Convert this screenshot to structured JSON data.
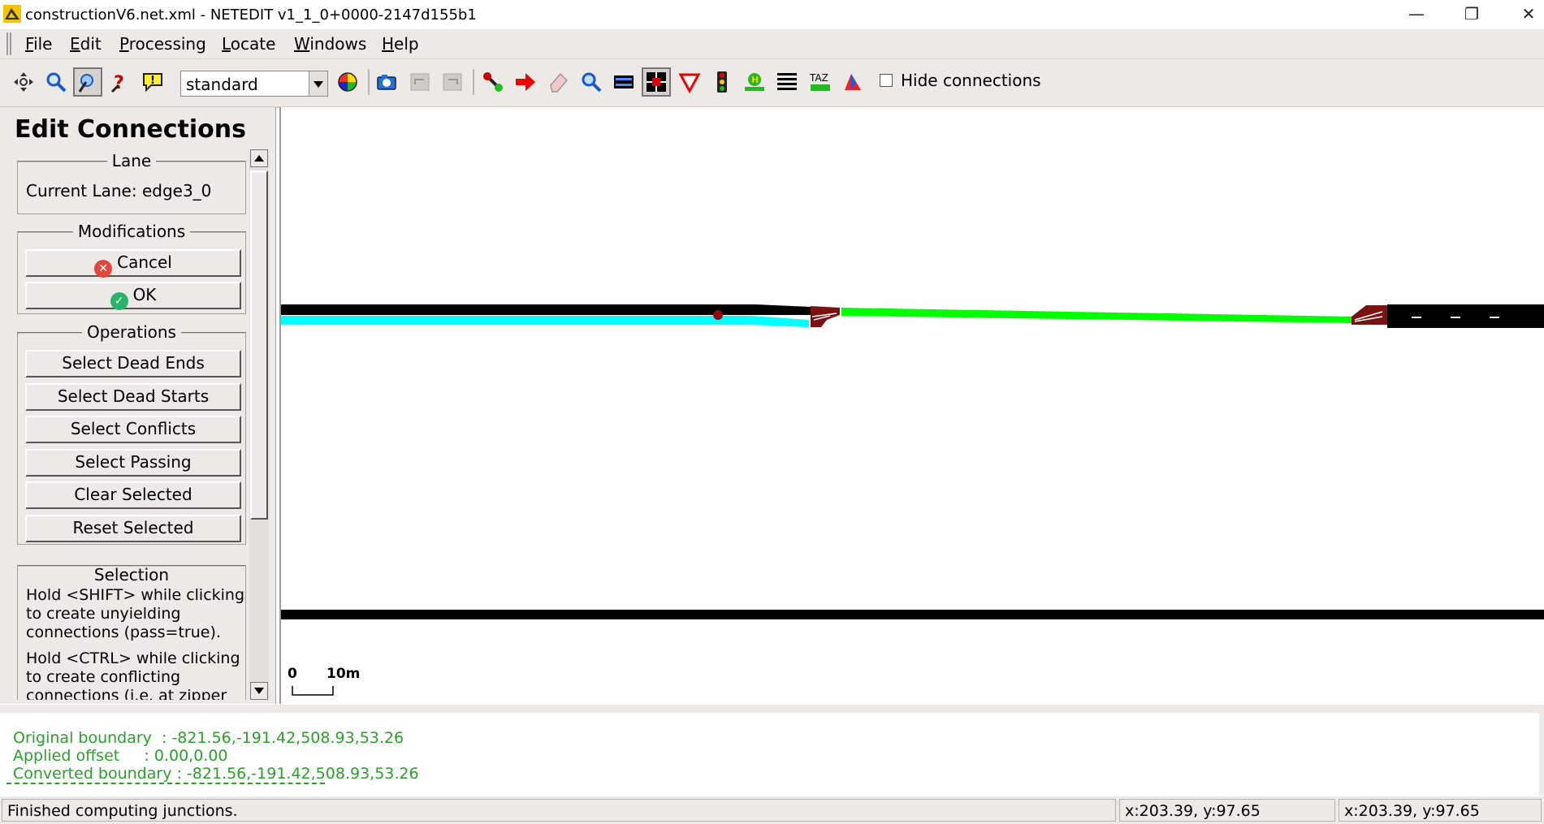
{
  "window": {
    "title": "constructionV6.net.xml - NETEDIT v1_1_0+0000-2147d155b1",
    "app_icon": "netedit-app-icon",
    "controls": [
      "minimize-icon",
      "restore-icon",
      "close-icon"
    ]
  },
  "menu": {
    "items": [
      {
        "label": "File",
        "accel": "F"
      },
      {
        "label": "Edit",
        "accel": "E"
      },
      {
        "label": "Processing",
        "accel": "P"
      },
      {
        "label": "Locate",
        "accel": "L"
      },
      {
        "label": "Windows",
        "accel": "W"
      },
      {
        "label": "Help",
        "accel": "H"
      }
    ]
  },
  "toolbar": {
    "scheme_value": "standard",
    "hide_connections_label": "Hide connections",
    "hide_connections_checked": false,
    "icons": [
      "recenter-view-icon",
      "zoom-icon",
      "locate-icon",
      "inspect-icon",
      "tooltip-icon",
      "color-wheel-icon",
      "screenshot-icon",
      "undo-icon",
      "redo-icon",
      "create-edge-icon",
      "move-icon",
      "delete-icon",
      "inspect-mode-icon",
      "select-mode-icon",
      "connection-mode-icon",
      "prohibition-icon",
      "traffic-light-icon",
      "additional-icon",
      "crossing-icon",
      "taz-icon",
      "polygon-icon"
    ]
  },
  "panel": {
    "title": "Edit Connections",
    "lane": {
      "header": "Lane",
      "current": "Current Lane: edge3_0"
    },
    "modifications": {
      "header": "Modifications",
      "cancel": "Cancel",
      "ok": "OK"
    },
    "operations": {
      "header": "Operations",
      "buttons": [
        "Select Dead Ends",
        "Select Dead Starts",
        "Select Conflicts",
        "Select Passing",
        "Clear Selected",
        "Reset Selected"
      ]
    },
    "selection": {
      "header": "Selection",
      "text1": "Hold <SHIFT> while clicking to create unyielding connections (pass=true).",
      "text2": "Hold <CTRL> while clicking to create conflicting connections (i.e. at zipper"
    }
  },
  "canvas": {
    "scale_zero": "0",
    "scale_label": "10m",
    "colors": {
      "road": "#000000",
      "source_lane": "#00ffff",
      "target_lane": "#00ff00",
      "junction": "#7a1212"
    }
  },
  "messages": {
    "line1": "Original boundary  : -821.56,-191.42,508.93,53.26",
    "line2": "Applied offset     : 0.00,0.00",
    "line3": "Converted boundary : -821.56,-191.42,508.93,53.26"
  },
  "status": {
    "text": "Finished computing junctions.",
    "coord1": "x:203.39, y:97.65",
    "coord2": "x:203.39, y:97.65"
  }
}
